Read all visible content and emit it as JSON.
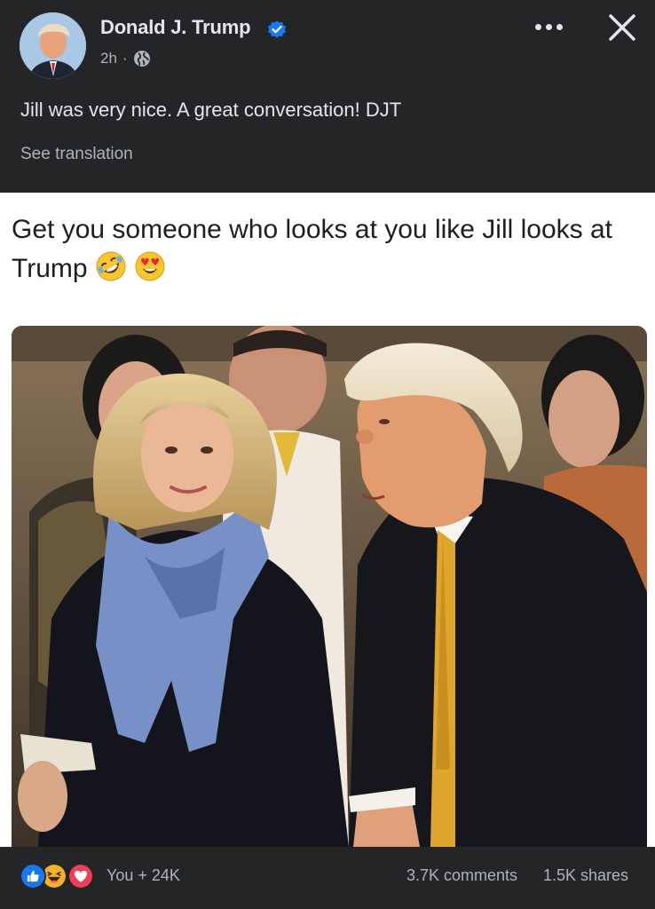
{
  "post": {
    "author": {
      "name": "Donald J. Trump",
      "verified": true,
      "avatar_icon": "profile-avatar"
    },
    "timestamp": "2h",
    "separator": "·",
    "audience_icon": "globe-icon",
    "text": "Jill was very nice. A great conversation! DJT",
    "see_translation_label": "See translation"
  },
  "shared_image": {
    "caption": "Get you someone who looks at you like Jill looks at Trump",
    "caption_emojis": [
      "rolling-on-floor-laughing-emoji",
      "heart-eyes-emoji"
    ]
  },
  "reactions": {
    "icons": [
      "like-icon",
      "haha-icon",
      "love-icon"
    ],
    "count_label": "You + 24K",
    "comments_label": "3.7K comments",
    "shares_label": "1.5K shares"
  },
  "colors": {
    "background": "#242526",
    "text_primary": "#e4e6eb",
    "text_secondary": "#b0b3b8",
    "verified_blue": "#1877f2",
    "like_blue": "#1877f2",
    "love_red": "#f33e58",
    "haha_yellow": "#f7b125"
  }
}
